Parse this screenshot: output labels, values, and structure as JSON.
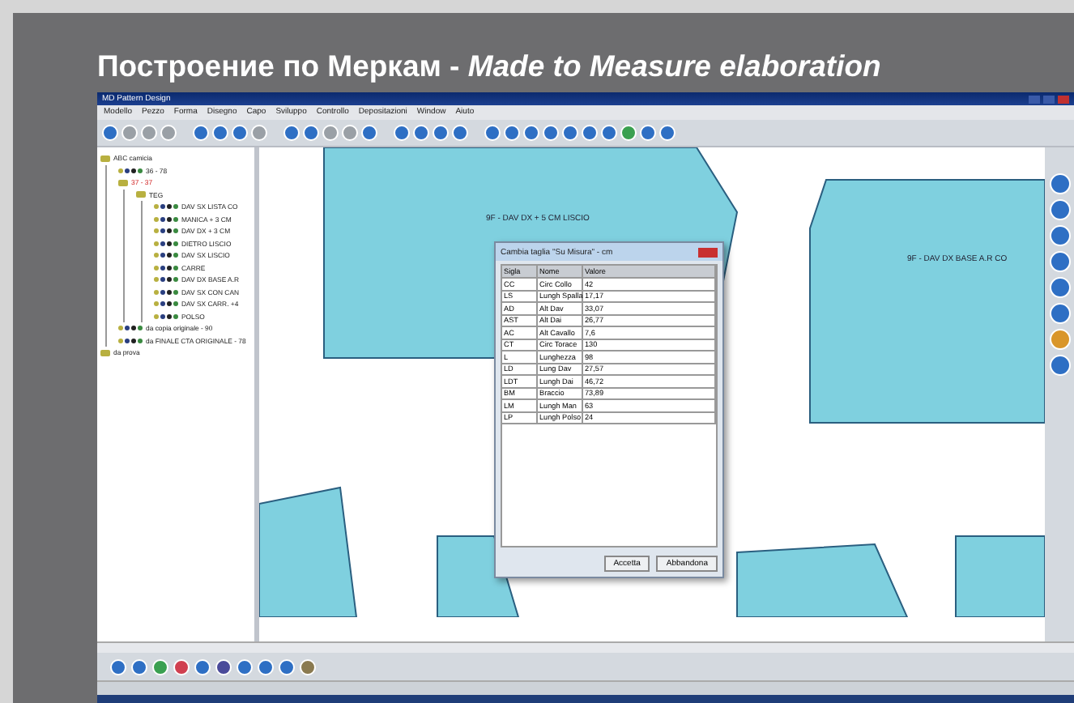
{
  "slide_title": "Построение по Меркам - *Made to Measure elaboration*",
  "window": {
    "title": "MD Pattern Design"
  },
  "menu": [
    "Modello",
    "Pezzo",
    "Forma",
    "Disegno",
    "Capo",
    "Sviluppo",
    "Controllo",
    "Depositazioni",
    "Window",
    "Aiuto"
  ],
  "tree": [
    {
      "label": "ABC camicia",
      "selected": false,
      "children": [
        {
          "label": "36 - 78",
          "selected": false
        },
        {
          "label": "37 - 37",
          "selected": true,
          "children": [
            {
              "label": "TEG",
              "selected": false,
              "children": [
                {
                  "label": "DAV SX LISTA CO",
                  "selected": false
                },
                {
                  "label": "MANICA + 3 CM",
                  "selected": false
                },
                {
                  "label": "DAV DX + 3 CM",
                  "selected": false
                },
                {
                  "label": "DIETRO LISCIO",
                  "selected": false
                },
                {
                  "label": "DAV SX LISCIO",
                  "selected": false
                },
                {
                  "label": "CARRE",
                  "selected": false
                },
                {
                  "label": "DAV DX BASE A.R",
                  "selected": false
                },
                {
                  "label": "DAV SX CON CAN",
                  "selected": false
                },
                {
                  "label": "DAV SX CARR. +4",
                  "selected": false
                },
                {
                  "label": "POLSO",
                  "selected": false
                }
              ]
            }
          ]
        },
        {
          "label": "da copia originale - 90",
          "selected": false
        },
        {
          "label": "da FINALE CTA ORIGINALE - 78",
          "selected": false
        }
      ]
    },
    {
      "label": "da prova",
      "selected": false
    }
  ],
  "canvas": {
    "piece_labels": [
      "9F - DAV DX + 5 CM LISCIO",
      "9F - DAV DX BASE A.R CO"
    ]
  },
  "dialog": {
    "title": "Cambia taglia \"Su Misura\" - cm",
    "columns": [
      "Sigla",
      "Nome",
      "Valore"
    ],
    "rows": [
      [
        "CC",
        "Circ Collo",
        "42"
      ],
      [
        "LS",
        "Lungh Spalla",
        "17,17"
      ],
      [
        "AD",
        "Alt Dav",
        "33,07"
      ],
      [
        "AST",
        "Alt Dai",
        "26,77"
      ],
      [
        "AC",
        "Alt Cavallo",
        "7,6"
      ],
      [
        "CT",
        "Circ Torace",
        "130"
      ],
      [
        "L",
        "Lunghezza",
        "98"
      ],
      [
        "LD",
        "Lung Dav",
        "27,57"
      ],
      [
        "LDT",
        "Lungh Dai",
        "46,72"
      ],
      [
        "BM",
        "Braccio",
        "73,89"
      ],
      [
        "LM",
        "Lungh Man",
        "63"
      ],
      [
        "LP",
        "Lungh Polso",
        "24"
      ]
    ],
    "buttons": [
      "Accetta",
      "Abbandona"
    ]
  }
}
